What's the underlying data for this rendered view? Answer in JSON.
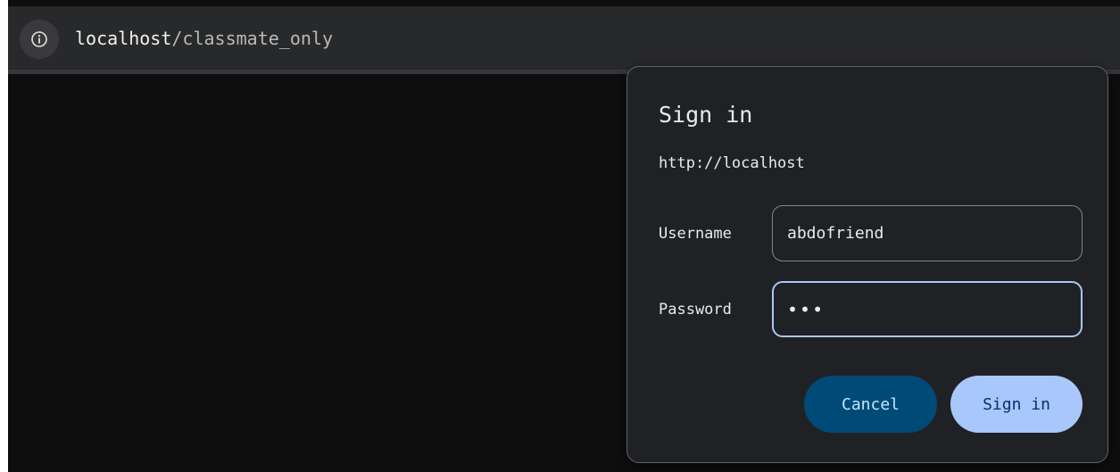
{
  "browser": {
    "address_bar": {
      "host": "localhost",
      "path": "/classmate_only",
      "info_icon": "info-icon"
    }
  },
  "dialog": {
    "title": "Sign in",
    "origin": "http://localhost",
    "username_label": "Username",
    "username_value": "abdofriend",
    "password_label": "Password",
    "password_masked": "•••",
    "cancel_label": "Cancel",
    "signin_label": "Sign in"
  },
  "colors": {
    "dialog_bg": "#202124",
    "focus_ring": "#a8c7fa",
    "cancel_bg": "#004a77",
    "signin_bg": "#a8c7fa"
  }
}
